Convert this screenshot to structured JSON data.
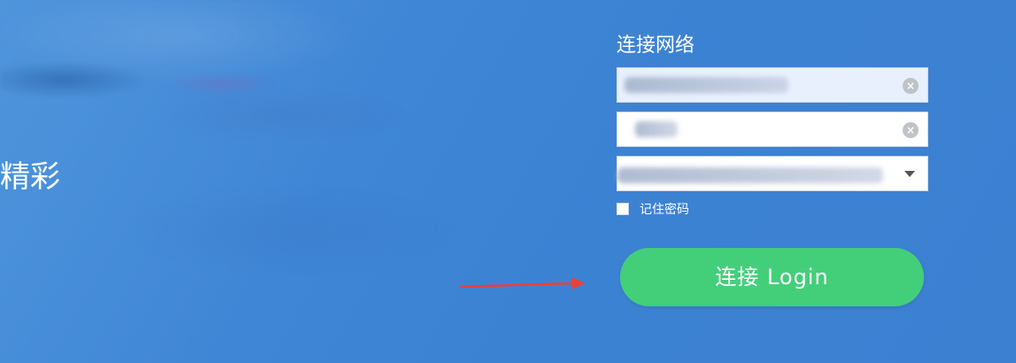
{
  "hero": {
    "tagline": "精彩"
  },
  "login_form": {
    "title": "连接网络",
    "username": {
      "value": "",
      "filled": true
    },
    "password": {
      "value": "",
      "filled": false
    },
    "network_select": {
      "selected": ""
    },
    "remember_label": "记住密码",
    "remember_checked": false,
    "submit_label": "连接 Login"
  },
  "colors": {
    "background": "#3f86d6",
    "button": "#43cf7a",
    "annotation_arrow": "#e8413a"
  },
  "icons": {
    "clear": "clear-circle-icon",
    "dropdown": "chevron-down-icon"
  }
}
